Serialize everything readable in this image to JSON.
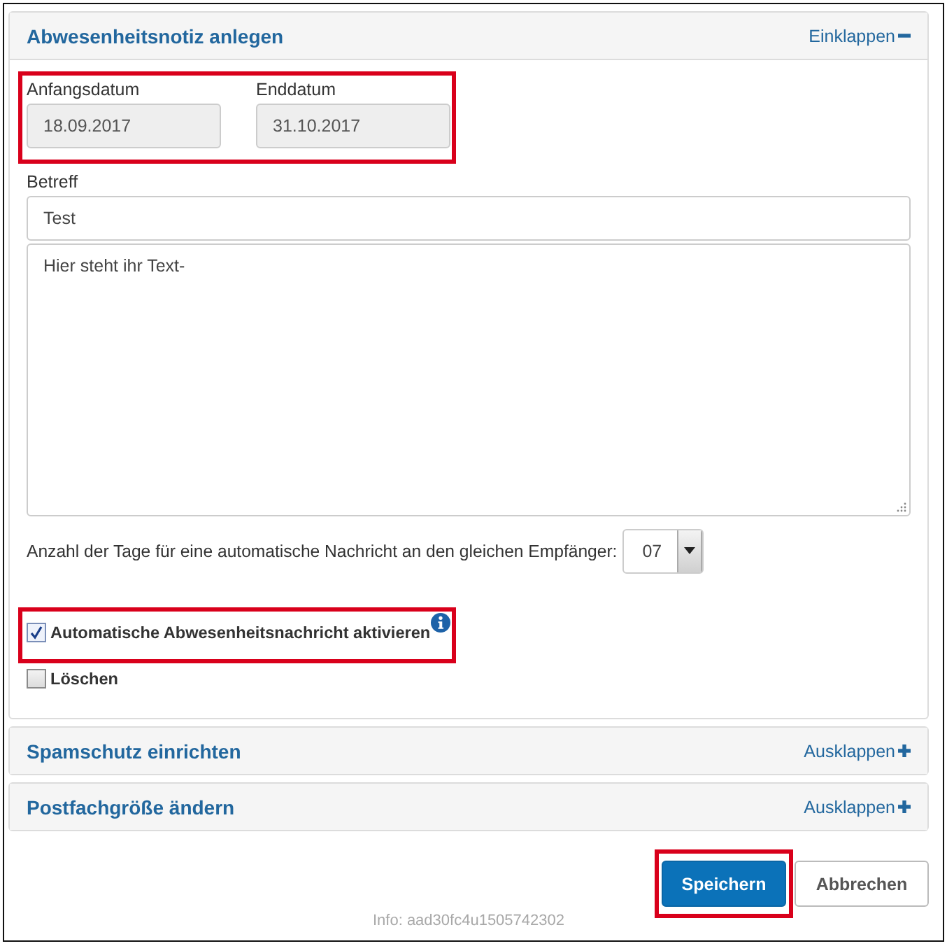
{
  "panels": [
    {
      "title": "Abwesenheitsnotiz anlegen",
      "toggle": "Einklappen",
      "expanded": true,
      "form": {
        "dates": {
          "highlighted": true,
          "fields": [
            {
              "label": "Anfangsdatum",
              "value": "18.09.2017",
              "disabled": true
            },
            {
              "label": "Enddatum",
              "value": "31.10.2017",
              "disabled": true
            }
          ]
        },
        "subject": {
          "label": "Betreff",
          "value": "Test"
        },
        "message": {
          "value": "Hier steht ihr Text-"
        },
        "days": {
          "label": "Anzahl der Tage für eine automatische Nachricht an den gleichen Empfänger:",
          "value": "07"
        },
        "checkboxes": [
          {
            "label": "Automatische Abwesenheitsnachricht aktivieren",
            "checked": true,
            "info": true,
            "highlighted": true
          },
          {
            "label": "Löschen",
            "checked": false,
            "info": false,
            "highlighted": false
          }
        ]
      }
    },
    {
      "title": "Spamschutz einrichten",
      "toggle": "Ausklappen",
      "expanded": false
    },
    {
      "title": "Postfachgröße ändern",
      "toggle": "Ausklappen",
      "expanded": false
    }
  ],
  "buttons": [
    {
      "label": "Speichern",
      "kind": "primary",
      "highlighted": true
    },
    {
      "label": "Abbrechen",
      "kind": "default",
      "highlighted": false
    }
  ],
  "footer_info": "Info: aad30fc4u1505742302"
}
